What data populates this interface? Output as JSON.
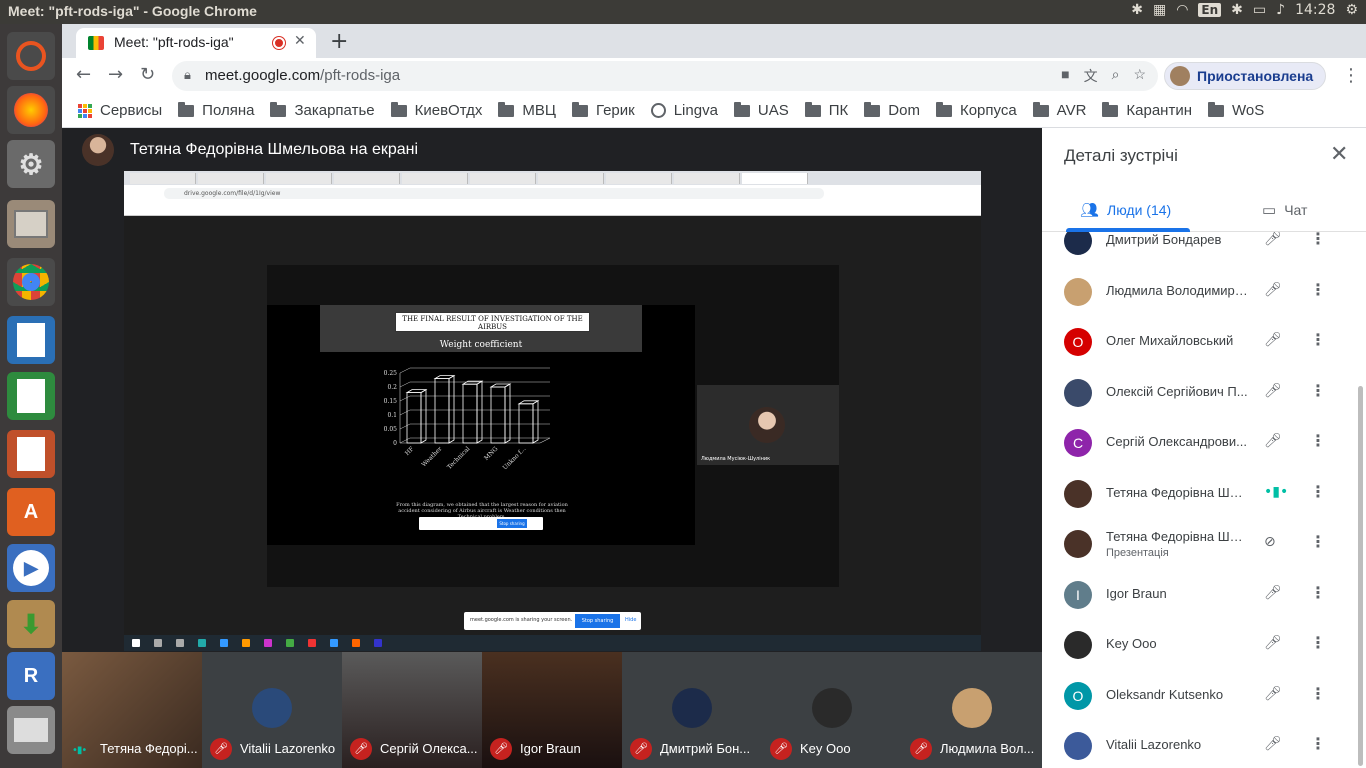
{
  "os": {
    "window_title": "Meet: \"pft-rods-iga\" - Google Chrome",
    "lang": "En",
    "time": "14:28"
  },
  "browser": {
    "tab_title": "Meet: \"pft-rods-iga\"",
    "url_host": "meet.google.com",
    "url_path": "/pft-rods-iga",
    "profile_label": "Приостановлена",
    "bookmarks": [
      "Сервисы",
      "Поляна",
      "Закарпатье",
      "КиевОтдх",
      "МВЦ",
      "Герик",
      "Lingva",
      "UAS",
      "ПК",
      "Dom",
      "Корпуса",
      "AVR",
      "Карантин",
      "WoS"
    ]
  },
  "meet": {
    "presenter_label": "Тетяна Федорівна Шмельова на екрані",
    "shared_screen": {
      "inner_url": "drive.google.com/file/d/1Ig/view",
      "slide_title": "THE FINAL RESULT OF INVESTIGATION OF THE AIRBUS",
      "slide_subtitle": "Weight coefficient",
      "slide_text": "From this diagram, we obtained that the largest reason for aviation accident considering of Airbus aircraft is Weather conditions then Technical problem.",
      "thumb_name": "Людмила Мусіюк-Шуліник",
      "share_text": "meet.google.com is sharing your screen.",
      "share_stop": "Stop sharing",
      "share_hide": "Hide"
    },
    "participants_strip": [
      {
        "name": "Тетяна Федорі...",
        "state": "talking"
      },
      {
        "name": "Vitalii Lazorenko",
        "state": "muted"
      },
      {
        "name": "Сергій Олекса...",
        "state": "muted"
      },
      {
        "name": "Igor Braun",
        "state": "muted"
      },
      {
        "name": "Дмитрий Бон...",
        "state": "muted"
      },
      {
        "name": "Key Ooo",
        "state": "muted"
      },
      {
        "name": "Людмила Вол...",
        "state": "muted"
      }
    ]
  },
  "chart_data": {
    "type": "bar",
    "categories": [
      "HF",
      "Weather",
      "Technical",
      "MNG",
      "Unkno f..."
    ],
    "values": [
      0.18,
      0.23,
      0.21,
      0.2,
      0.14
    ],
    "ylim": [
      0,
      0.25
    ],
    "yticks": [
      "0",
      "0.05",
      "0.1",
      "0.15",
      "0.2",
      "0.25"
    ],
    "grid": true,
    "style": "3d-wireframe"
  },
  "panel": {
    "title": "Деталі зустрічі",
    "tab_people": "Люди (14)",
    "tab_chat": "Чат",
    "people": [
      {
        "name": "Дмитрий Бондарев",
        "sub": "",
        "initial": "",
        "color": "#1c2b4a",
        "mic": "muted"
      },
      {
        "name": "Людмила Володимирі...",
        "sub": "",
        "initial": "",
        "color": "#c8a070",
        "mic": "muted"
      },
      {
        "name": "Олег Михайловський",
        "sub": "",
        "initial": "О",
        "color": "#d50000",
        "mic": "muted"
      },
      {
        "name": "Олексій Сергійович П...",
        "sub": "",
        "initial": "",
        "color": "#3a4a6a",
        "mic": "muted"
      },
      {
        "name": "Сергій Олександрови...",
        "sub": "",
        "initial": "С",
        "color": "#8e24aa",
        "mic": "muted"
      },
      {
        "name": "Тетяна Федорівна Шме...",
        "sub": "",
        "initial": "",
        "color": "#4a3228",
        "mic": "talking"
      },
      {
        "name": "Тетяна Федорівна Шме...",
        "sub": "Презентація",
        "initial": "",
        "color": "#4a3228",
        "mic": "off"
      },
      {
        "name": "Igor Braun",
        "sub": "",
        "initial": "I",
        "color": "#607d8b",
        "mic": "muted"
      },
      {
        "name": "Key Ooo",
        "sub": "",
        "initial": "",
        "color": "#2a2a2a",
        "mic": "muted"
      },
      {
        "name": "Oleksandr Kutsenko",
        "sub": "",
        "initial": "O",
        "color": "#0097a7",
        "mic": "muted"
      },
      {
        "name": "Vitalii Lazorenko",
        "sub": "",
        "initial": "",
        "color": "#3c5a9a",
        "mic": "muted"
      }
    ]
  }
}
